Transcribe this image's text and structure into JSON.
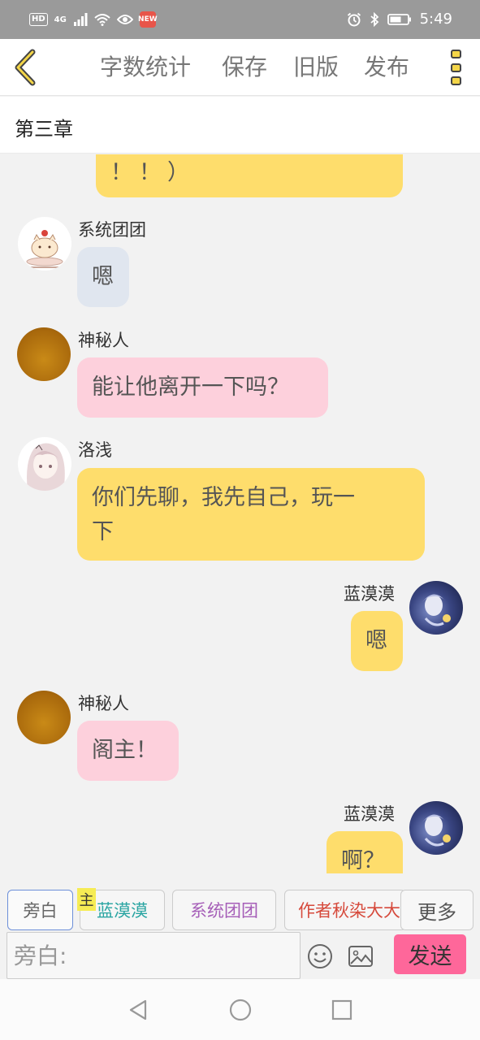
{
  "status_bar": {
    "left_badge": "HD",
    "network": "4G",
    "app_badge": "NEW",
    "time": "5:49"
  },
  "header": {
    "word_count": "字数统计",
    "save": "保存",
    "old_version": "旧版",
    "publish": "发布"
  },
  "chapter": {
    "title": "第三章"
  },
  "messages": [
    {
      "sender": "",
      "side": "right",
      "text": "！！）",
      "color": "#fedd6c"
    },
    {
      "sender": "系统团团",
      "side": "left",
      "text": "嗯",
      "color": "#e0e6ef"
    },
    {
      "sender": "神秘人",
      "side": "left",
      "text": "能让他离开一下吗？",
      "color": "#fdd0dc"
    },
    {
      "sender": "洛浅",
      "side": "left",
      "text_line1": "你们先聊，我先自己，玩一",
      "text_line2": "下",
      "color": "#fedd6c"
    },
    {
      "sender": "蓝漠漠",
      "side": "right",
      "text": "嗯",
      "color": "#fedd6c"
    },
    {
      "sender": "神秘人",
      "side": "left",
      "text": "阁主！",
      "color": "#fdd0dc"
    },
    {
      "sender": "蓝漠漠",
      "side": "right",
      "text": "啊？",
      "color": "#fedd6c"
    }
  ],
  "character_tabs": [
    {
      "label": "旁白",
      "color": "#666666",
      "active": true
    },
    {
      "label": "蓝漠漠",
      "color": "#2aa5a2",
      "main": true
    },
    {
      "label": "系统团团",
      "color": "#a65fb8"
    },
    {
      "label": "作者秋染大大",
      "color": "#d64a3c"
    }
  ],
  "main_badge": "主",
  "more_label": "更多",
  "input": {
    "placeholder": "旁白:"
  },
  "send_label": "发送",
  "icons": {
    "back": "chevron-left-icon",
    "menu": "more-vertical-icon",
    "emoji": "emoji-icon",
    "image": "image-icon",
    "nav_back": "triangle-back-icon",
    "nav_home": "circle-home-icon",
    "nav_recent": "square-recent-icon"
  },
  "colors": {
    "accent_yellow": "#fedd6c",
    "pink_bubble": "#fdd0dc",
    "gray_bubble": "#e0e6ef",
    "send_pink": "#fe679a"
  }
}
